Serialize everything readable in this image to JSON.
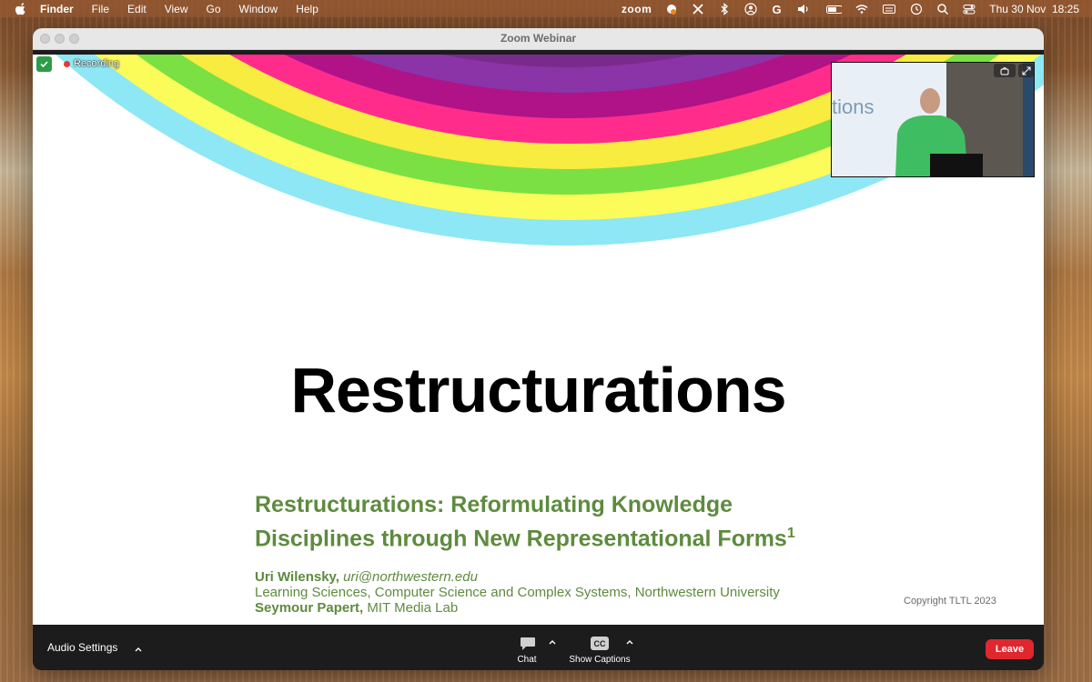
{
  "menubar": {
    "apple": "apple-icon",
    "items": [
      "Finder",
      "File",
      "Edit",
      "View",
      "Go",
      "Window",
      "Help"
    ],
    "zoom_label": "zoom",
    "clock": "Thu 30 Nov  18:25"
  },
  "window": {
    "title": "Zoom Webinar"
  },
  "share": {
    "recording_label": "Recording",
    "slide": {
      "title": "Restructurations",
      "subtitle_line1": "Restructurations: Reformulating Knowledge",
      "subtitle_line2": "Disciplines through New Representational Forms",
      "subtitle_sup": "1",
      "author1_name": "Uri Wilensky,",
      "author1_email": "uri@northwestern.edu",
      "author1_affiliation": "Learning Sciences, Computer Science and Complex Systems, Northwestern University",
      "author2_name": "Seymour Papert,",
      "author2_affiliation": " MIT Media Lab",
      "copyright": "Copyright TLTL 2023",
      "rainbow_colors": [
        "#8a34a8",
        "#b01288",
        "#ff2c8c",
        "#f7ec3f",
        "#7be043",
        "#fbfb5a",
        "#8ee7f4"
      ]
    },
    "video": {
      "slide_text": "tions"
    }
  },
  "toolbar": {
    "audio_settings": "Audio Settings",
    "chat": "Chat",
    "captions": "Show Captions",
    "captions_badge": "CC",
    "leave": "Leave"
  },
  "colors": {
    "leave": "#e0262f",
    "subtitle_green": "#5e8b3e",
    "recording_red": "#e53935",
    "shield_green": "#2e9b48"
  }
}
